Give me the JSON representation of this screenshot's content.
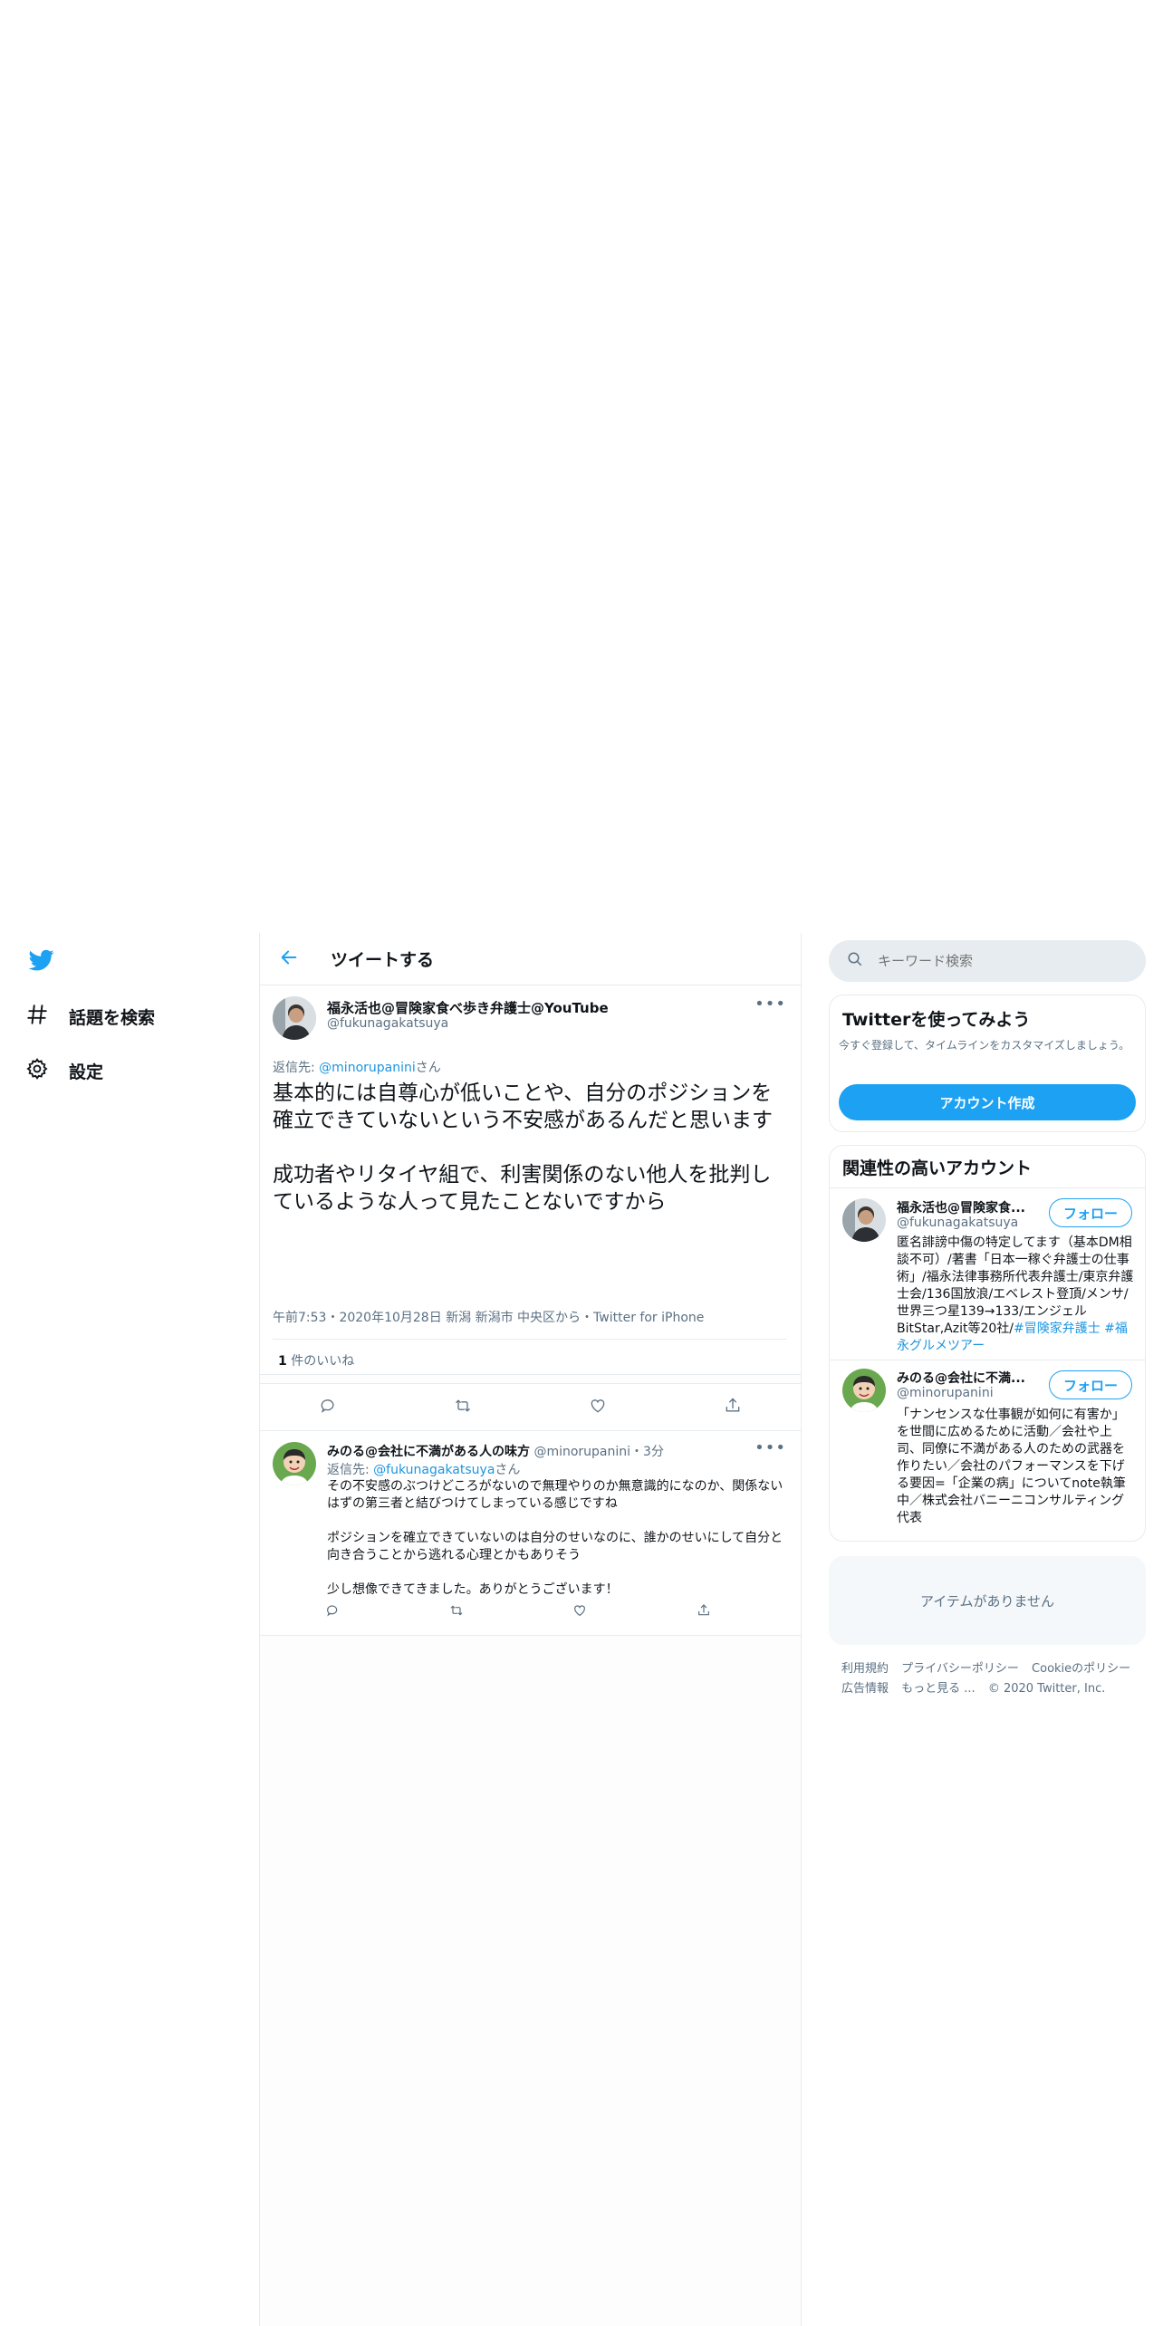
{
  "nav": {
    "logo_icon": "twitter-bird-icon",
    "items": [
      {
        "label": "話題を検索",
        "icon": "hashtag-icon"
      },
      {
        "label": "設定",
        "icon": "gear-icon"
      }
    ]
  },
  "header": {
    "title": "ツイートする"
  },
  "main_tweet": {
    "name": "福永活也@冒険家食べ歩き弁護士@YouTube",
    "handle": "@fukunagakatsuya",
    "reply_prefix": "返信先: ",
    "reply_handle": "@minorupanini",
    "reply_suffix": "さん",
    "text_p1": "基本的には自尊心が低いことや、自分のポジションを確立できていないという不安感があるんだと思います",
    "text_p2": "成功者やリタイヤ組で、利害関係のない他人を批判しているような人って見たことないですから",
    "meta": "午前7:53・2020年10月28日 新潟 新潟市 中央区から・Twitter for iPhone",
    "likes_count": "1",
    "likes_label": " 件のいいね"
  },
  "reply_tweet": {
    "name": "みのる@会社に不満がある人の味方",
    "handle": "@minorupanini",
    "time": "・3分",
    "reply_prefix": "返信先: ",
    "reply_handle": "@fukunagakatsuya",
    "reply_suffix": "さん",
    "p1": "その不安感のぶつけどころがないので無理やりのか無意識的になのか、関係ないはずの第三者と結びつけてしまっている感じですね",
    "p2": "ポジションを確立できていないのは自分のせいなのに、誰かのせいにして自分と向き合うことから逃れる心理とかもありそう",
    "p3": "少し想像できてきました。ありがとうございます！"
  },
  "search": {
    "placeholder": "キーワード検索"
  },
  "signup": {
    "title": "Twitterを使ってみよう",
    "desc": "今すぐ登録して、タイムラインをカスタマイズしましょう。",
    "button": "アカウント作成"
  },
  "related": {
    "title": "関連性の高いアカウント",
    "follow_label": "フォロー",
    "accounts": [
      {
        "name": "福永活也@冒険家食...",
        "handle": "@fukunagakatsuya",
        "bio": "匿名誹謗中傷の特定してます（基本DM相談不可）/著書「日本一稼ぐ弁護士の仕事術」/福永法律事務所代表弁護士/東京弁護士会/136国放浪/エベレスト登頂/メンサ/世界三つ星139→133/エンジェルBitStar,Azit等20社/",
        "bio_tags": "#冒険家弁護士 #福永グルメツアー"
      },
      {
        "name": "みのる@会社に不満...",
        "handle": "@minorupanini",
        "bio": "「ナンセンスな仕事観が如何に有害か」を世間に広めるために活動／会社や上司、同僚に不満がある人のための武器を作りたい／会社のパフォーマンスを下げる要因=「企業の病」についてnote執筆中／株式会社バニーニコンサルティング代表",
        "bio_tags": ""
      }
    ]
  },
  "trends": {
    "empty_label": "アイテムがありません"
  },
  "footer": {
    "links": [
      "利用規約",
      "プライバシーポリシー",
      "Cookieのポリシー",
      "広告情報",
      "もっと見る ..."
    ],
    "copyright": "© 2020 Twitter, Inc."
  },
  "colors": {
    "accent": "#1da1f2",
    "link": "#1b95e0",
    "muted": "#5b7083",
    "border": "#e6ecf0"
  }
}
